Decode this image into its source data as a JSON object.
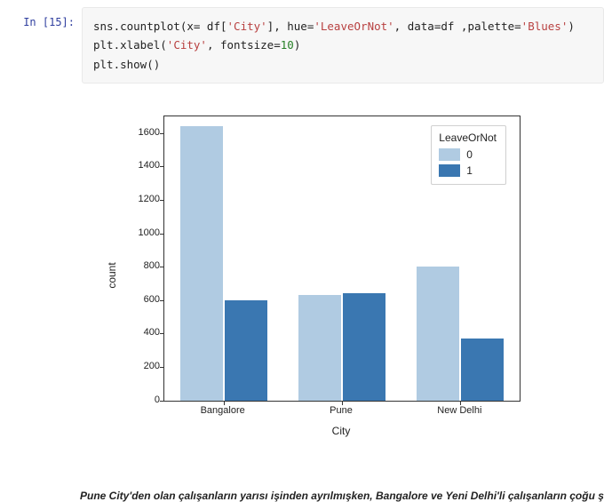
{
  "cell": {
    "prompt": "In [15]:",
    "code": {
      "l1a": "sns.countplot(x= df[",
      "l1b": "'City'",
      "l1c": "], hue=",
      "l1d": "'LeaveOrNot'",
      "l1e": ", data=df ,palette=",
      "l1f": "'Blues'",
      "l1g": ")",
      "l2a": "plt.xlabel(",
      "l2b": "'City'",
      "l2c": ", fontsize=",
      "l2d": "10",
      "l2e": ")",
      "l3": "plt.show()"
    }
  },
  "chart_data": {
    "type": "bar",
    "categories": [
      "Bangalore",
      "Pune",
      "New Delhi"
    ],
    "series": [
      {
        "name": "0",
        "values": [
          1640,
          630,
          800
        ]
      },
      {
        "name": "1",
        "values": [
          600,
          640,
          370
        ]
      }
    ],
    "xlabel": "City",
    "ylabel": "count",
    "ylim": [
      0,
      1700
    ],
    "yticks": [
      0,
      200,
      400,
      600,
      800,
      1000,
      1200,
      1400,
      1600
    ],
    "legend_title": "LeaveOrNot"
  },
  "caption": "Pune City'den olan çalışanların yarısı işinden ayrılmışken, Bangalore ve Yeni Delhi'li çalışanların çoğu şirket"
}
